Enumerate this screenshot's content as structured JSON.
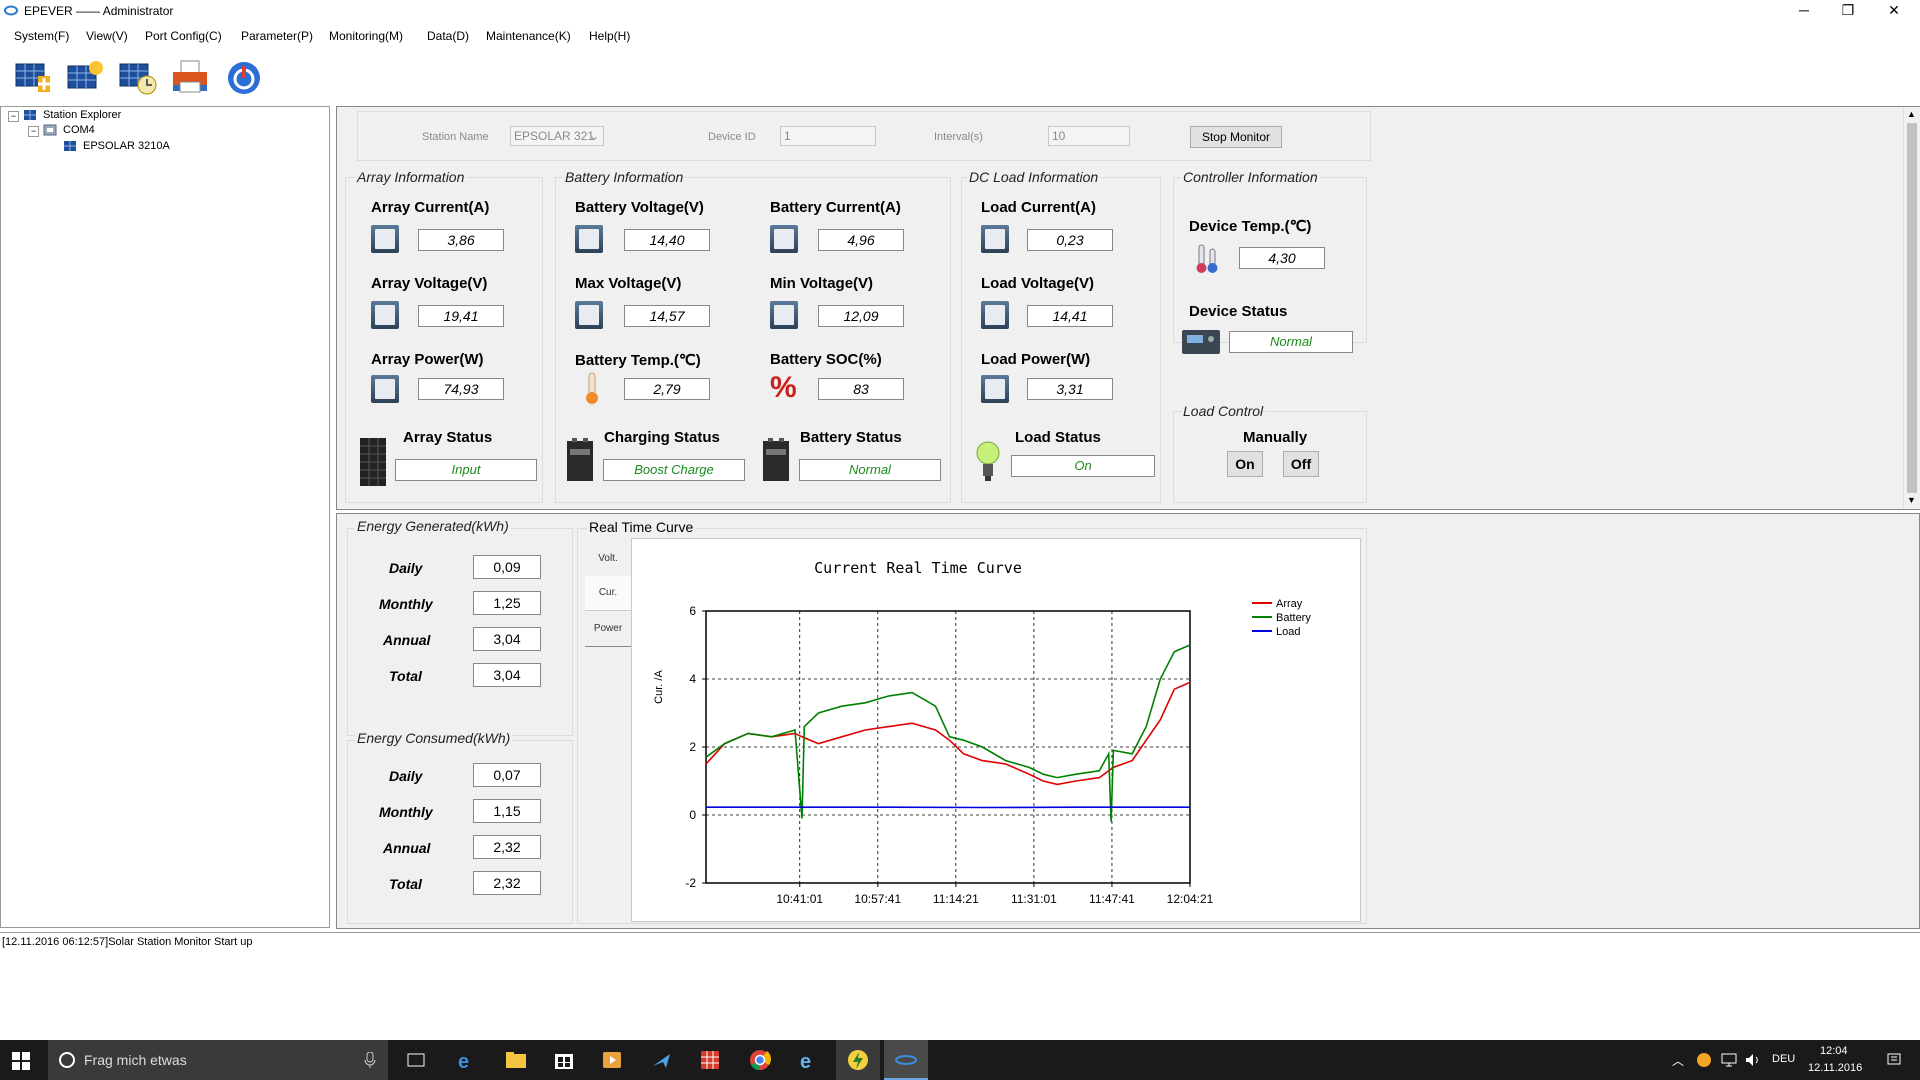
{
  "window": {
    "title": "EPEVER —— Administrator",
    "min": "─",
    "max": "❐",
    "close": "✕"
  },
  "menu": [
    "System(F)",
    "View(V)",
    "Port Config(C)",
    "Parameter(P)",
    "Monitoring(M)",
    "Data(D)",
    "Maintenance(K)",
    "Help(H)"
  ],
  "explorer": {
    "root": "Station Explorer",
    "port": "COM4",
    "device": "EPSOLAR 3210A"
  },
  "station": {
    "name_label": "Station Name",
    "name_value": "EPSOLAR 321",
    "device_id_label": "Device ID",
    "device_id_value": "1",
    "interval_label": "Interval(s)",
    "interval_value": "10",
    "stop_button": "Stop Monitor"
  },
  "array": {
    "title": "Array Information",
    "current_label": "Array Current(A)",
    "current": "3,86",
    "voltage_label": "Array Voltage(V)",
    "voltage": "19,41",
    "power_label": "Array Power(W)",
    "power": "74,93",
    "status_label": "Array Status",
    "status": "Input"
  },
  "battery": {
    "title": "Battery Information",
    "voltage_label": "Battery Voltage(V)",
    "voltage": "14,40",
    "current_label": "Battery Current(A)",
    "current": "4,96",
    "max_label": "Max Voltage(V)",
    "max": "14,57",
    "min_label": "Min Voltage(V)",
    "min": "12,09",
    "temp_label": "Battery Temp.(℃)",
    "temp": "2,79",
    "soc_label": "Battery SOC(%)",
    "soc": "83",
    "charging_label": "Charging Status",
    "charging": "Boost Charge",
    "status_label": "Battery Status",
    "status": "Normal"
  },
  "load": {
    "title": "DC Load Information",
    "current_label": "Load Current(A)",
    "current": "0,23",
    "voltage_label": "Load Voltage(V)",
    "voltage": "14,41",
    "power_label": "Load Power(W)",
    "power": "3,31",
    "status_label": "Load Status",
    "status": "On"
  },
  "controller": {
    "title": "Controller Information",
    "temp_label": "Device Temp.(℃)",
    "temp": "4,30",
    "status_label": "Device Status",
    "status": "Normal"
  },
  "load_control": {
    "title": "Load Control",
    "mode": "Manually",
    "on": "On",
    "off": "Off"
  },
  "energy_gen": {
    "title": "Energy Generated(kWh)",
    "rows": [
      {
        "label": "Daily",
        "value": "0,09"
      },
      {
        "label": "Monthly",
        "value": "1,25"
      },
      {
        "label": "Annual",
        "value": "3,04"
      },
      {
        "label": "Total",
        "value": "3,04"
      }
    ]
  },
  "energy_con": {
    "title": "Energy Consumed(kWh)",
    "rows": [
      {
        "label": "Daily",
        "value": "0,07"
      },
      {
        "label": "Monthly",
        "value": "1,15"
      },
      {
        "label": "Annual",
        "value": "2,32"
      },
      {
        "label": "Total",
        "value": "2,32"
      }
    ]
  },
  "rt": {
    "title": "Real Time Curve",
    "tabs": [
      "Volt.",
      "Cur.",
      "Power"
    ]
  },
  "chart_data": {
    "type": "line",
    "title": "Current Real Time Curve",
    "ylabel": "Cur. /A",
    "ylim": [
      -2,
      6
    ],
    "yticks": [
      "6",
      "4",
      "2",
      "0",
      "-2"
    ],
    "xticks": [
      "10:41:01",
      "10:57:41",
      "11:14:21",
      "11:31:01",
      "11:47:41",
      "12:04:21"
    ],
    "legend_position": "top-right",
    "series": [
      {
        "name": "Array",
        "color": "#e00000",
        "x": [
          "10:21:00",
          "10:25:00",
          "10:30:00",
          "10:35:00",
          "10:40:00",
          "10:41:30",
          "10:45:00",
          "10:50:00",
          "10:55:00",
          "11:00:00",
          "11:05:00",
          "11:10:00",
          "11:13:00",
          "11:16:00",
          "11:20:00",
          "11:25:00",
          "11:30:00",
          "11:33:00",
          "11:36:00",
          "11:40:00",
          "11:45:00",
          "11:48:00",
          "11:52:00",
          "11:55:00",
          "11:58:00",
          "12:01:00",
          "12:04:21"
        ],
        "values": [
          1.5,
          2.1,
          2.4,
          2.3,
          2.4,
          2.3,
          2.1,
          2.3,
          2.5,
          2.6,
          2.7,
          2.5,
          2.2,
          1.8,
          1.6,
          1.5,
          1.2,
          1.0,
          0.9,
          1.0,
          1.1,
          1.4,
          1.6,
          2.2,
          2.8,
          3.7,
          3.9
        ]
      },
      {
        "name": "Battery",
        "color": "#008000",
        "x": [
          "10:21:00",
          "10:25:00",
          "10:30:00",
          "10:35:00",
          "10:40:00",
          "10:41:30",
          "10:42:00",
          "10:45:00",
          "10:50:00",
          "10:55:00",
          "11:00:00",
          "11:05:00",
          "11:10:00",
          "11:13:00",
          "11:16:00",
          "11:20:00",
          "11:25:00",
          "11:30:00",
          "11:33:00",
          "11:36:00",
          "11:40:00",
          "11:45:00",
          "11:47:00",
          "11:47:30",
          "11:48:00",
          "11:52:00",
          "11:55:00",
          "11:58:00",
          "12:01:00",
          "12:04:21"
        ],
        "values": [
          1.7,
          2.1,
          2.4,
          2.3,
          2.5,
          -0.1,
          2.6,
          3.0,
          3.2,
          3.3,
          3.5,
          3.6,
          3.2,
          2.3,
          2.2,
          2.0,
          1.6,
          1.4,
          1.2,
          1.1,
          1.2,
          1.3,
          1.8,
          -0.2,
          1.9,
          1.8,
          2.6,
          4.0,
          4.8,
          5.0
        ]
      },
      {
        "name": "Load",
        "color": "#0000e0",
        "x": [
          "10:21:00",
          "10:41:00",
          "11:00:00",
          "11:20:00",
          "11:40:00",
          "12:04:21"
        ],
        "values": [
          0.23,
          0.23,
          0.23,
          0.22,
          0.23,
          0.23
        ]
      }
    ]
  },
  "log": "[12.11.2016 06:12:57]Solar Station Monitor Start up",
  "taskbar": {
    "search": "Frag mich etwas",
    "lang": "DEU",
    "time": "12:04",
    "date": "12.11.2016"
  }
}
